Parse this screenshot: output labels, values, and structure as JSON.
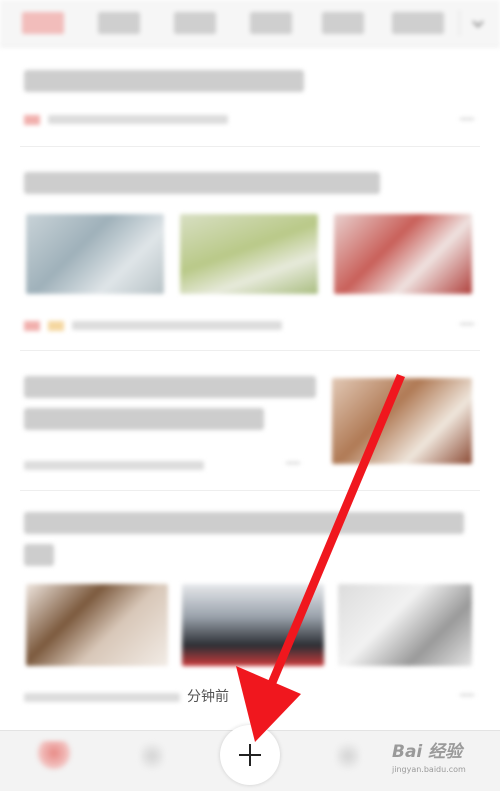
{
  "clear_time_text": "分钟前",
  "watermark": {
    "title": "Bai 经验",
    "subtitle": "jingyan.baidu.com"
  },
  "colors": {
    "accent": "#e86a66",
    "arrow": "#f0171e"
  },
  "icons": {
    "add": "plus-icon",
    "home": "home-icon"
  }
}
